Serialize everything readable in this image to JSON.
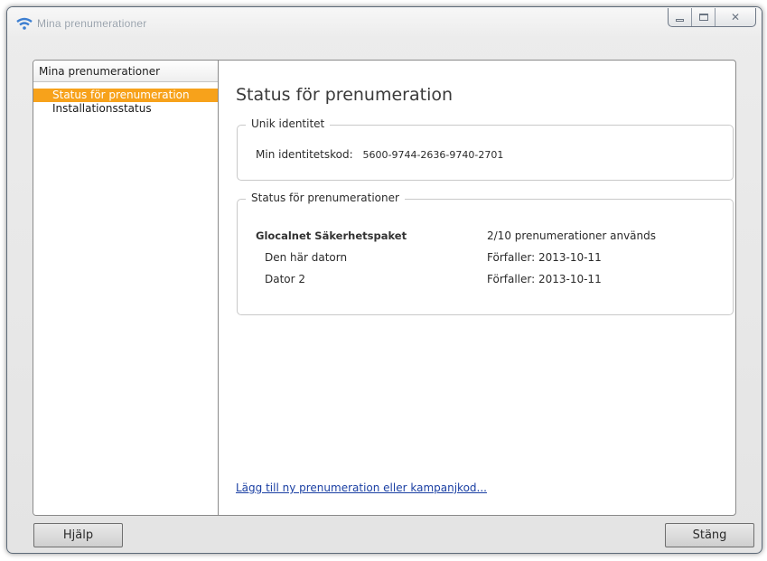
{
  "window": {
    "title": "Mina prenumerationer",
    "controls": {
      "minimize": "minimize-icon",
      "maximize": "maximize-icon",
      "close": "close-icon"
    }
  },
  "sidebar": {
    "header": "Mina prenumerationer",
    "items": [
      {
        "label": "Status för prenumeration",
        "active": true
      },
      {
        "label": "Installationsstatus",
        "active": false
      }
    ]
  },
  "main": {
    "title": "Status för prenumeration",
    "identity": {
      "legend": "Unik identitet",
      "label": "Min identitetskod:",
      "code": "5600-9744-2636-9740-2701"
    },
    "subscriptions": {
      "legend": "Status för prenumerationer",
      "product": {
        "name": "Glocalnet Säkerhetspaket",
        "usage": "2/10 prenumerationer används"
      },
      "devices": [
        {
          "name": "Den här datorn",
          "expires": "Förfaller: 2013-10-11"
        },
        {
          "name": "Dator 2",
          "expires": "Förfaller: 2013-10-11"
        }
      ]
    },
    "add_link": "Lägg till ny prenumeration eller kampanjkod..."
  },
  "footer": {
    "help_label": "Hjälp",
    "close_label": "Stäng"
  },
  "colors": {
    "accent": "#f7a21b",
    "link": "#1a3fa3"
  }
}
